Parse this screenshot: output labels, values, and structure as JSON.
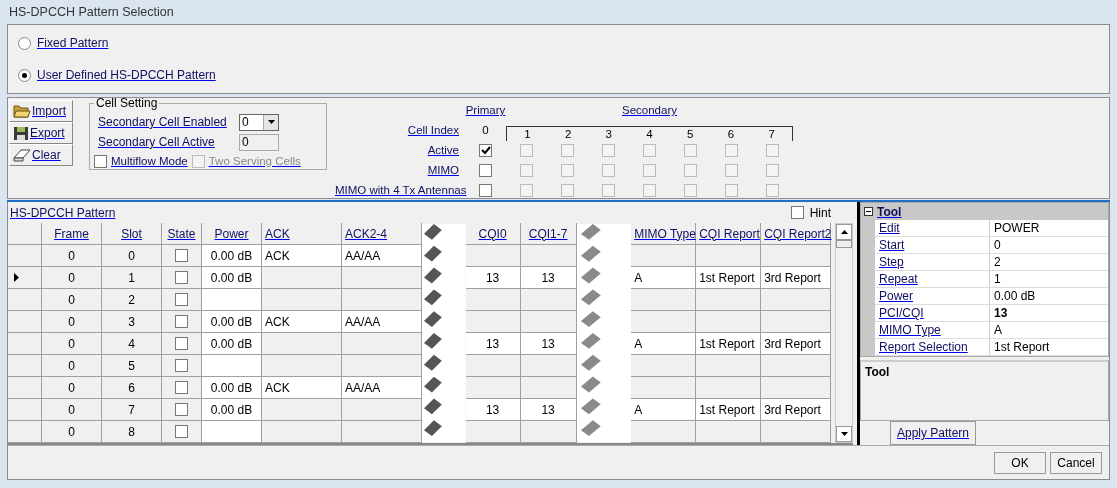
{
  "window": {
    "title": "HS-DPCCH Pattern Selection"
  },
  "pattern_mode": [
    {
      "label": "Fixed Pattern",
      "selected": false
    },
    {
      "label": "User Defined HS-DPCCH Pattern",
      "selected": true
    }
  ],
  "file_buttons": [
    {
      "label": "Import",
      "kind": "import"
    },
    {
      "label": "Export",
      "kind": "export"
    },
    {
      "label": "Clear",
      "kind": "clear"
    }
  ],
  "cell_setting": {
    "title": "Cell Setting",
    "enabled_label": "Secondary Cell Enabled",
    "enabled_value": "0",
    "active_label": "Secondary Cell Active",
    "active_value": "0",
    "multiflow": {
      "label": "Multiflow Mode",
      "checked": false,
      "disabled": false
    },
    "two_serving": {
      "label": "Two Serving Cells",
      "checked": false,
      "disabled": true
    }
  },
  "cells": {
    "primary_label": "Primary",
    "secondary_label": "Secondary",
    "index_label": "Cell Index",
    "indices": [
      "0",
      "1",
      "2",
      "3",
      "4",
      "5",
      "6",
      "7"
    ],
    "rows": [
      {
        "label": "Active",
        "boxes": [
          {
            "checked": true,
            "disabled": false
          },
          {
            "checked": false,
            "disabled": true
          },
          {
            "checked": false,
            "disabled": true
          },
          {
            "checked": false,
            "disabled": true
          },
          {
            "checked": false,
            "disabled": true
          },
          {
            "checked": false,
            "disabled": true
          },
          {
            "checked": false,
            "disabled": true
          },
          {
            "checked": false,
            "disabled": true
          }
        ]
      },
      {
        "label": "MIMO",
        "boxes": [
          {
            "checked": false,
            "disabled": false
          },
          {
            "checked": false,
            "disabled": true
          },
          {
            "checked": false,
            "disabled": true
          },
          {
            "checked": false,
            "disabled": true
          },
          {
            "checked": false,
            "disabled": true
          },
          {
            "checked": false,
            "disabled": true
          },
          {
            "checked": false,
            "disabled": true
          },
          {
            "checked": false,
            "disabled": true
          }
        ]
      },
      {
        "label": "MIMO with 4 Tx Antennas",
        "boxes": [
          {
            "checked": false,
            "disabled": false
          },
          {
            "checked": false,
            "disabled": true
          },
          {
            "checked": false,
            "disabled": true
          },
          {
            "checked": false,
            "disabled": true
          },
          {
            "checked": false,
            "disabled": true
          },
          {
            "checked": false,
            "disabled": true
          },
          {
            "checked": false,
            "disabled": true
          },
          {
            "checked": false,
            "disabled": true
          }
        ]
      }
    ]
  },
  "pattern": {
    "title": "HS-DPCCH Pattern",
    "hint": {
      "label": "Hint",
      "checked": false
    },
    "columns": [
      "Frame",
      "Slot",
      "State",
      "Power",
      "ACK",
      "ACK2-4",
      "CQI0",
      "CQI1-7",
      "MIMO Type",
      "CQI Report",
      "CQI Report2"
    ],
    "rows": [
      {
        "current": false,
        "frame": "0",
        "slot": "0",
        "state": false,
        "power": "0.00 dB",
        "ack": "ACK",
        "ack2_4": "AA/AA"
      },
      {
        "current": true,
        "frame": "0",
        "slot": "1",
        "state": false,
        "power": "0.00 dB",
        "cqi0": "13",
        "cqi1_7": "13",
        "mimo_type": "A",
        "cqi_report": "1st Report",
        "cqi_report2": "3rd Report"
      },
      {
        "current": false,
        "frame": "0",
        "slot": "2",
        "state": false
      },
      {
        "current": false,
        "frame": "0",
        "slot": "3",
        "state": false,
        "power": "0.00 dB",
        "ack": "ACK",
        "ack2_4": "AA/AA"
      },
      {
        "current": false,
        "frame": "0",
        "slot": "4",
        "state": false,
        "power": "0.00 dB",
        "cqi0": "13",
        "cqi1_7": "13",
        "mimo_type": "A",
        "cqi_report": "1st Report",
        "cqi_report2": "3rd Report"
      },
      {
        "current": false,
        "frame": "0",
        "slot": "5",
        "state": false
      },
      {
        "current": false,
        "frame": "0",
        "slot": "6",
        "state": false,
        "power": "0.00 dB",
        "ack": "ACK",
        "ack2_4": "AA/AA"
      },
      {
        "current": false,
        "frame": "0",
        "slot": "7",
        "state": false,
        "power": "0.00 dB",
        "cqi0": "13",
        "cqi1_7": "13",
        "mimo_type": "A",
        "cqi_report": "1st Report",
        "cqi_report2": "3rd Report"
      },
      {
        "current": false,
        "frame": "0",
        "slot": "8",
        "state": false
      }
    ]
  },
  "tool": {
    "category": "Tool",
    "expanded": true,
    "rows": [
      {
        "label": "Edit",
        "value": "POWER",
        "bold": false
      },
      {
        "label": "Start",
        "value": "0",
        "bold": false
      },
      {
        "label": "Step",
        "value": "2",
        "bold": false
      },
      {
        "label": "Repeat",
        "value": "1",
        "bold": false
      },
      {
        "label": "Power",
        "value": "0.00 dB",
        "bold": false
      },
      {
        "label": "PCI/CQI",
        "value": "13",
        "bold": true
      },
      {
        "label": "MIMO Type",
        "value": "A",
        "bold": false
      },
      {
        "label": "Report Selection",
        "value": "1st Report",
        "bold": false
      }
    ],
    "description_title": "Tool",
    "apply_button": "Apply Pattern"
  },
  "buttons": [
    "OK",
    "Cancel"
  ]
}
